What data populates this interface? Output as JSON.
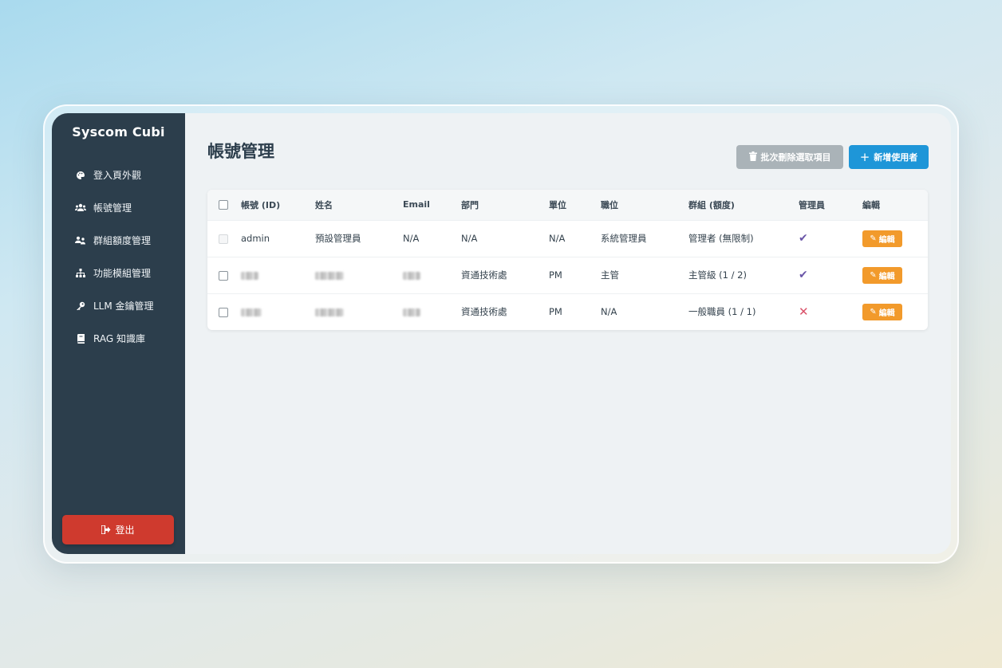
{
  "sidebar": {
    "brand": "Syscom Cubi",
    "items": [
      {
        "icon": "palette-icon",
        "glyph": "🎨",
        "label": "登入頁外觀"
      },
      {
        "icon": "users-icon",
        "glyph": "👥",
        "label": "帳號管理"
      },
      {
        "icon": "user-group-icon",
        "glyph": "👥",
        "label": "群組額度管理"
      },
      {
        "icon": "sitemap-icon",
        "glyph": "⛬",
        "label": "功能模組管理"
      },
      {
        "icon": "key-icon",
        "glyph": "🔑",
        "label": "LLM 金鑰管理"
      },
      {
        "icon": "book-icon",
        "glyph": "📘",
        "label": "RAG 知識庫"
      }
    ],
    "logout_label": "登出"
  },
  "page": {
    "title": "帳號管理",
    "batch_delete_label": "批次刪除選取項目",
    "add_user_label": "新增使用者"
  },
  "table": {
    "headers": [
      "帳號 (ID)",
      "姓名",
      "Email",
      "部門",
      "單位",
      "職位",
      "群組 (額度)",
      "管理員",
      "編輯"
    ],
    "edit_label": "編輯",
    "rows": [
      {
        "id": "admin",
        "name": "預設管理員",
        "email": "N/A",
        "dept": "N/A",
        "unit": "N/A",
        "title": "系統管理員",
        "group": "管理者 (無限制)",
        "is_admin": true,
        "checkbox_disabled": true,
        "redacted": false
      },
      {
        "id": "",
        "name": "",
        "email": "",
        "dept": "資通技術處",
        "unit": "PM",
        "title": "主管",
        "group": "主管級 (1 / 2)",
        "is_admin": true,
        "checkbox_disabled": false,
        "redacted": true
      },
      {
        "id": "",
        "name": "",
        "email": "",
        "dept": "資通技術處",
        "unit": "PM",
        "title": "N/A",
        "group": "一般職員 (1 / 1)",
        "is_admin": false,
        "checkbox_disabled": false,
        "redacted": true
      }
    ]
  },
  "colors": {
    "sidebar_bg": "#2c3e4c",
    "logout": "#cf3a2e",
    "add_button": "#1e96d8",
    "edit_button": "#f29a2b",
    "admin_yes": "#6a56a8",
    "admin_no": "#d9526a"
  }
}
